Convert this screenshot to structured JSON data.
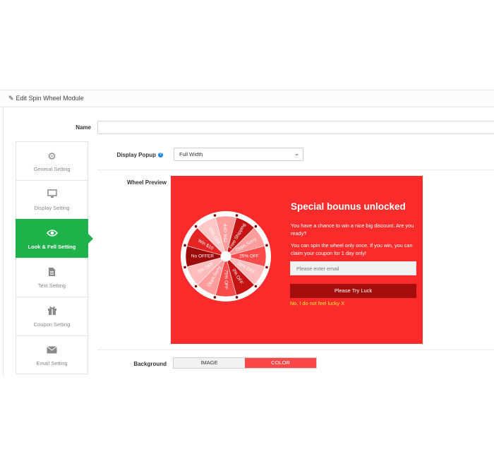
{
  "panel": {
    "title": "Edit Spin Wheel Module"
  },
  "form": {
    "name_label": "Name",
    "name_value": "",
    "display_popup_label": "Display Popup",
    "display_popup_value": "Full Width",
    "wheel_preview_label": "Wheel Preview",
    "background_label": "Background",
    "background_options": [
      "IMAGE",
      "COLOR"
    ],
    "background_selected": "COLOR"
  },
  "tabs": [
    {
      "label": "General Setting",
      "icon": "gear-icon",
      "active": false
    },
    {
      "label": "Display Setting",
      "icon": "monitor-icon",
      "active": false
    },
    {
      "label": "Look & Fell Setting",
      "icon": "eye-icon",
      "active": true
    },
    {
      "label": "Text Setting",
      "icon": "document-icon",
      "active": false
    },
    {
      "label": "Coupon Setting",
      "icon": "gift-icon",
      "active": false
    },
    {
      "label": "Email Setting",
      "icon": "envelope-icon",
      "active": false
    }
  ],
  "preview": {
    "title": "Special bounus unlocked",
    "text1": "You have a chance to win a nice big discount. Are you ready?",
    "text2": "You can spin the wheel only once. If you win, you can claim your coupon for 1 day only!",
    "email_placeholder": "Please enter email",
    "button_label": "Please Try Luck",
    "decline_label": "No, I do not feel lucky X",
    "background_color": "#fa2b2b",
    "wheel_segments": [
      "Free Shipping",
      "Opps,Sorry",
      "25% OFF",
      "10% OFF",
      "0% OFF",
      "75% OFF",
      "Opps,Sorry",
      "5% OFF",
      "No OFFER",
      "Win $10",
      "50% OFF",
      "75% OFF"
    ]
  }
}
